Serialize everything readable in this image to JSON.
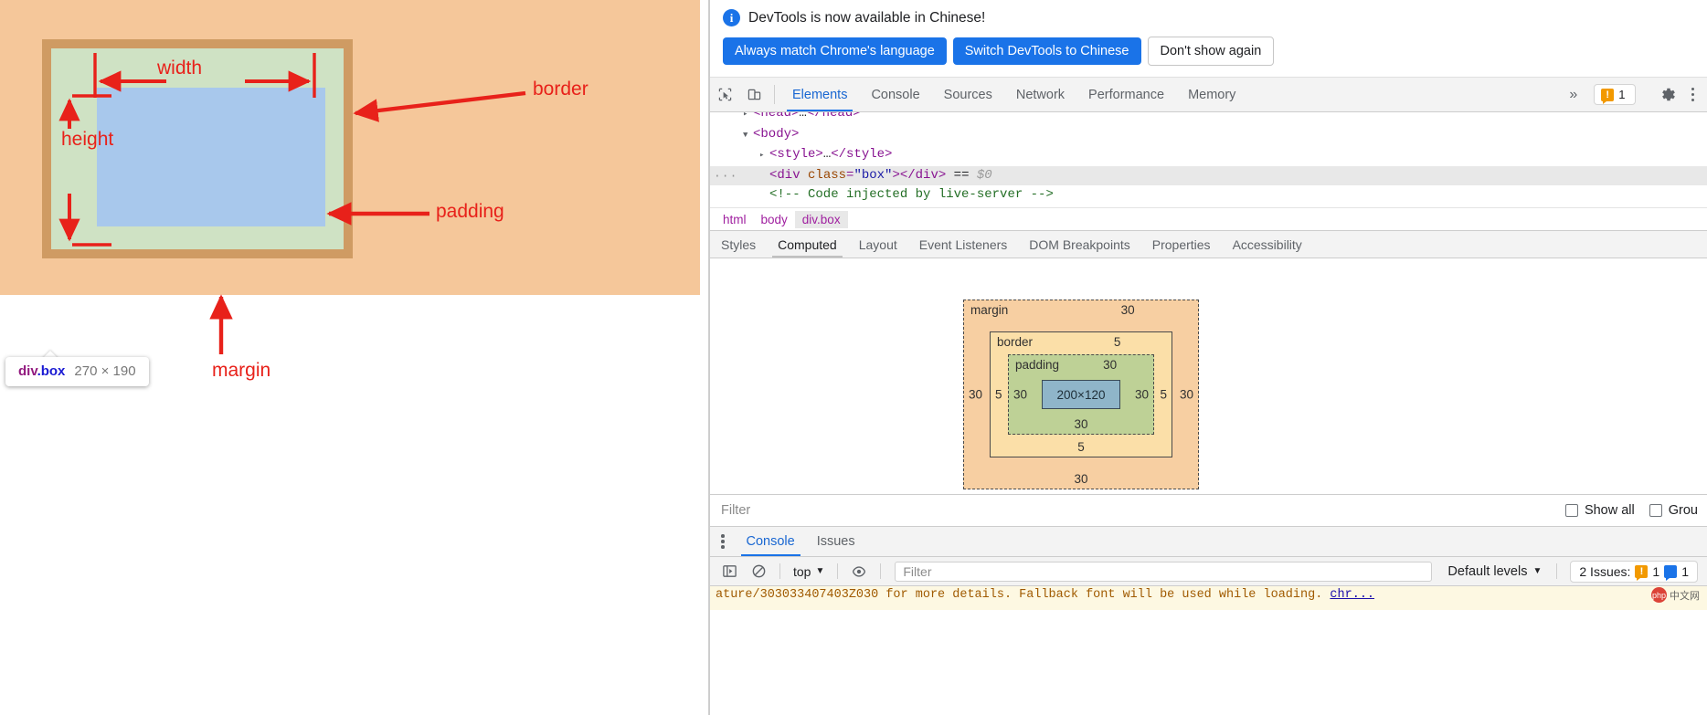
{
  "page": {
    "annotations": {
      "width": "width",
      "height": "height",
      "border": "border",
      "padding": "padding",
      "margin": "margin"
    },
    "inspect_tooltip": {
      "tag": "div",
      "class": ".box",
      "dimensions": "270 × 190"
    }
  },
  "devtools": {
    "banner": {
      "message": "DevTools is now available in Chinese!",
      "info_icon": "info-icon",
      "buttons": [
        {
          "label": "Always match Chrome's language",
          "style": "primary"
        },
        {
          "label": "Switch DevTools to Chinese",
          "style": "primary"
        },
        {
          "label": "Don't show again",
          "style": "plain"
        }
      ]
    },
    "toolbar": {
      "inspect_icon": "cursor-inspect-icon",
      "device_icon": "device-toolbar-icon",
      "more_tabs": "»",
      "warning_count": "1",
      "gear_icon": "gear-icon",
      "kebab_icon": "more-options-icon",
      "tabs": [
        {
          "label": "Elements",
          "active": true
        },
        {
          "label": "Console",
          "active": false
        },
        {
          "label": "Sources",
          "active": false
        },
        {
          "label": "Network",
          "active": false
        },
        {
          "label": "Performance",
          "active": false
        },
        {
          "label": "Memory",
          "active": false
        }
      ]
    },
    "dom_tree": {
      "lines": [
        {
          "indent": 1,
          "triangle": "▸",
          "parts": [
            {
              "t": "tag",
              "v": "<head>"
            },
            {
              "t": "plain",
              "v": "…"
            },
            {
              "t": "tag",
              "v": "</head>"
            }
          ],
          "selected": false,
          "clipped": true
        },
        {
          "indent": 1,
          "triangle": "▼",
          "parts": [
            {
              "t": "tag",
              "v": "<body>"
            }
          ],
          "selected": false
        },
        {
          "indent": 2,
          "triangle": "▸",
          "parts": [
            {
              "t": "tag",
              "v": "<style>"
            },
            {
              "t": "plain",
              "v": "…"
            },
            {
              "t": "tag",
              "v": "</style>"
            }
          ],
          "selected": false
        },
        {
          "indent": 2,
          "triangle": "",
          "parts": [
            {
              "t": "tag",
              "v": "<div "
            },
            {
              "t": "attr",
              "v": "class"
            },
            {
              "t": "tag",
              "v": "="
            },
            {
              "t": "val",
              "v": "\"box\""
            },
            {
              "t": "tag",
              "v": "></div>"
            },
            {
              "t": "plain",
              "v": " == "
            },
            {
              "t": "dollar",
              "v": "$0"
            }
          ],
          "selected": true,
          "handle": "···"
        },
        {
          "indent": 2,
          "triangle": "",
          "parts": [
            {
              "t": "cmt",
              "v": "<!-- Code injected by live-server -->"
            }
          ],
          "selected": false
        }
      ]
    },
    "breadcrumb": [
      {
        "label": "html",
        "active": false
      },
      {
        "label": "body",
        "active": false
      },
      {
        "label": "div.box",
        "active": true
      }
    ],
    "sub_tabs": [
      {
        "label": "Styles",
        "active": false
      },
      {
        "label": "Computed",
        "active": true
      },
      {
        "label": "Layout",
        "active": false
      },
      {
        "label": "Event Listeners",
        "active": false
      },
      {
        "label": "DOM Breakpoints",
        "active": false
      },
      {
        "label": "Properties",
        "active": false
      },
      {
        "label": "Accessibility",
        "active": false
      }
    ],
    "box_model": {
      "margin": {
        "label": "margin",
        "top": "30",
        "right": "30",
        "bottom": "30",
        "left": "30"
      },
      "border": {
        "label": "border",
        "top": "5",
        "right": "5",
        "bottom": "5",
        "left": "5"
      },
      "padding": {
        "label": "padding",
        "top": "30",
        "right": "30",
        "bottom": "30",
        "left": "30"
      },
      "content": "200×120"
    },
    "computed_filter": {
      "placeholder": "Filter",
      "value": "",
      "show_all_label": "Show all",
      "group_label": "Grou"
    },
    "drawer": {
      "kebab_icon": "drawer-more-options-icon",
      "tabs": [
        {
          "label": "Console",
          "active": true
        },
        {
          "label": "Issues",
          "active": false
        }
      ],
      "console_toolbar": {
        "sidebar_icon": "console-sidebar-icon",
        "clear_icon": "clear-console-icon",
        "context": "top",
        "eye_icon": "live-expression-icon",
        "filter_placeholder": "Filter",
        "filter_value": "",
        "levels_label": "Default levels",
        "issues_label": "2 Issues:",
        "issues_warning_count": "1",
        "issues_info_count": "1"
      },
      "console_output": {
        "line": "ature/303033407403Z030 for more details. Fallback font will be used while loading.",
        "link": "chr...",
        "watermark_text": "中文网"
      }
    }
  },
  "colors": {
    "accent_blue": "#1a73e8",
    "annotation_red": "#e8211a",
    "page_background": "#f5c79a",
    "box_border": "#cf9b63",
    "box_padding": "#cfe2c4",
    "box_content": "#a8c8ec",
    "bm_margin": "#f7cfa2",
    "bm_border": "#fbdfa8",
    "bm_padding": "#bed196",
    "bm_content": "#8fb5c9"
  }
}
